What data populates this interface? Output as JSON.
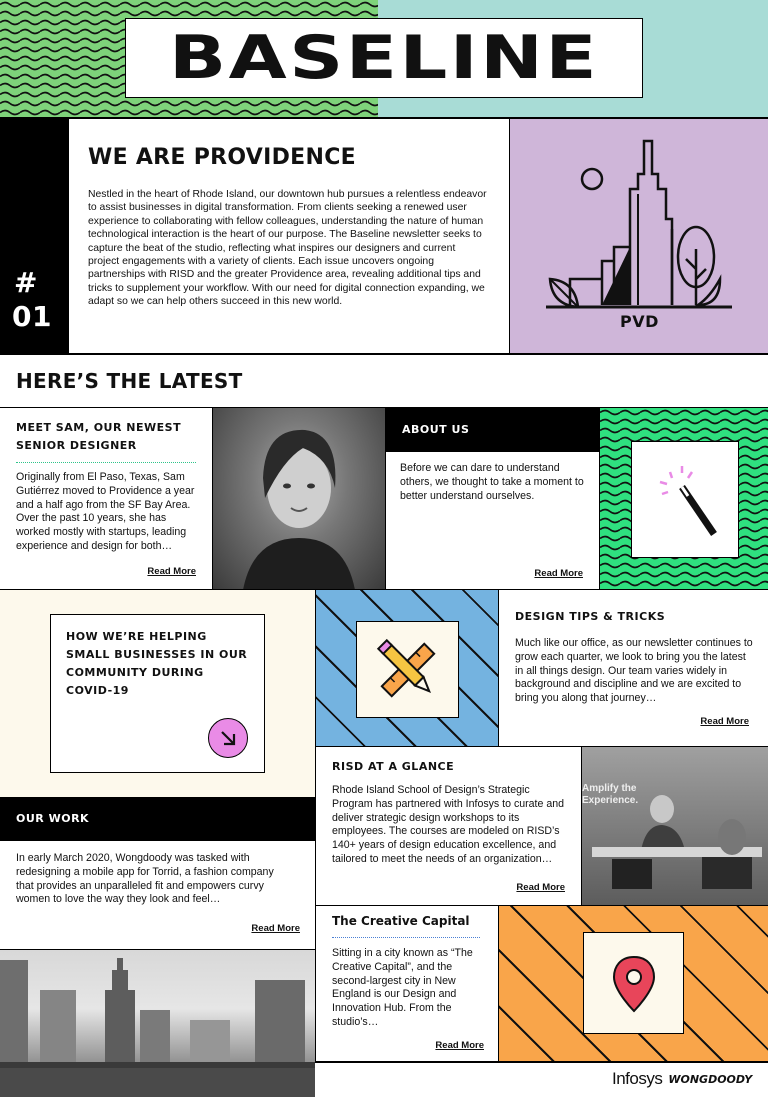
{
  "masthead": {
    "title": "BASELINE"
  },
  "issue": {
    "hash": "#",
    "number": "01"
  },
  "intro": {
    "heading": "WE ARE PROVIDENCE",
    "body": "Nestled in the heart of Rhode Island, our downtown hub pursues a relentless endeavor to assist businesses in digital transformation. From clients seeking a renewed user experience to collaborating with fellow colleagues, understanding the nature of human technological interaction is the heart of our purpose. The Baseline newsletter seeks to capture the beat of the studio, reflecting what inspires our designers and current project engagements with a variety of clients. Each issue uncovers ongoing partnerships with RISD and the greater Providence area, revealing additional tips and tricks to supplement your workflow. With our need for digital connection expanding, we adapt so we can help others succeed in this new world.",
    "illustration_label": "PVD"
  },
  "latest": {
    "heading": "HERE’S THE LATEST"
  },
  "sam": {
    "heading": "MEET SAM, OUR NEWEST SENIOR DESIGNER",
    "body": "Originally from El Paso, Texas, Sam Gutiérrez moved to Providence a year and a half ago from the SF Bay Area. Over the past 10 years, she has worked mostly with startups, leading experience and design for both…",
    "read_more": "Read More"
  },
  "about": {
    "heading": "ABOUT US",
    "body": "Before we can dare to understand others, we thought to take a moment to better understand ourselves.",
    "read_more": "Read More"
  },
  "covid": {
    "heading": "HOW WE’RE HELPING SMALL BUSINESSES IN OUR COMMUNITY DURING COVID-19"
  },
  "tips": {
    "heading": "DESIGN TIPS & TRICKS",
    "body": "Much like our office, as our newsletter continues to grow each quarter, we look to bring you the latest in all things design. Our team varies widely in background and discipline and we are excited to bring you along that journey…",
    "read_more": "Read More"
  },
  "risd": {
    "heading": "RISD AT A GLANCE",
    "body": "Rhode Island School of Design’s Strategic Program has partnered with Infosys to curate and deliver strategic design workshops to its employees. The courses are modeled on RISD’s 140+ years of design education excellence, and tailored to meet the needs of an organization…",
    "read_more": "Read More",
    "photo_sign": "Amplify the Experience."
  },
  "work": {
    "heading": "OUR WORK",
    "body": "In early March 2020, Wongdoody was tasked with redesigning a mobile app for Torrid, a fashion company that provides an unparalleled fit and empowers curvy women to love the way they look and feel…",
    "read_more": "Read More"
  },
  "creative": {
    "heading": "The Creative Capital",
    "body": "Sitting in a city known as “The Creative Capital”, and the second-largest city in New England is our Design and Innovation Hub. From the studio’s…",
    "read_more": "Read More"
  },
  "footer": {
    "brand1": "Infosys",
    "brand2": "WONGDOODY"
  },
  "colors": {
    "green": "#7ed37a",
    "mint": "#a8dcd6",
    "lavender": "#cfb6d9",
    "bright_green": "#2fe07f",
    "blue": "#74b3e0",
    "orange": "#f9a54a",
    "cream": "#fdf9ec",
    "pink": "#e98be6",
    "red": "#e8455a",
    "dotted": "#2ec48a"
  }
}
